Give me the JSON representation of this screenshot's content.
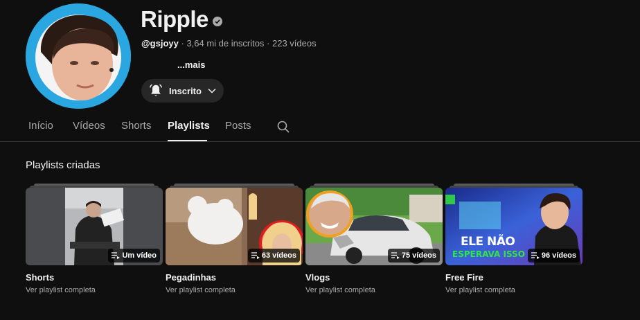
{
  "channel": {
    "name": "Ripple",
    "handle": "@gsjoyy",
    "subscribers": "3,64 mi de inscritos",
    "videos": "223 vídeos",
    "separator": " · ",
    "more": "...mais",
    "subscribe_label": "Inscrito"
  },
  "tabs": [
    {
      "label": "Início"
    },
    {
      "label": "Vídeos"
    },
    {
      "label": "Shorts"
    },
    {
      "label": "Playlists"
    },
    {
      "label": "Posts"
    }
  ],
  "active_tab": "Playlists",
  "section_title": "Playlists criadas",
  "playlists": [
    {
      "title": "Shorts",
      "count": "Um vídeo",
      "link": "Ver playlist completa"
    },
    {
      "title": "Pegadinhas",
      "count": "63 vídeos",
      "link": "Ver playlist completa"
    },
    {
      "title": "Vlogs",
      "count": "75 vídeos",
      "link": "Ver playlist completa"
    },
    {
      "title": "Free Fire",
      "count": "96 vídeos",
      "link": "Ver playlist completa"
    }
  ],
  "thumb_text": {
    "free_fire_line1": "ELE NÃO",
    "free_fire_line2": "ESPERAVA ISSO"
  },
  "colors": {
    "background": "#0f0f0f",
    "avatar_ring": "#2aa7e0",
    "muted_text": "#aaaaaa"
  },
  "icons": [
    "verified-badge-icon",
    "bell-icon",
    "chevron-down-icon",
    "search-icon",
    "playlist-icon"
  ]
}
